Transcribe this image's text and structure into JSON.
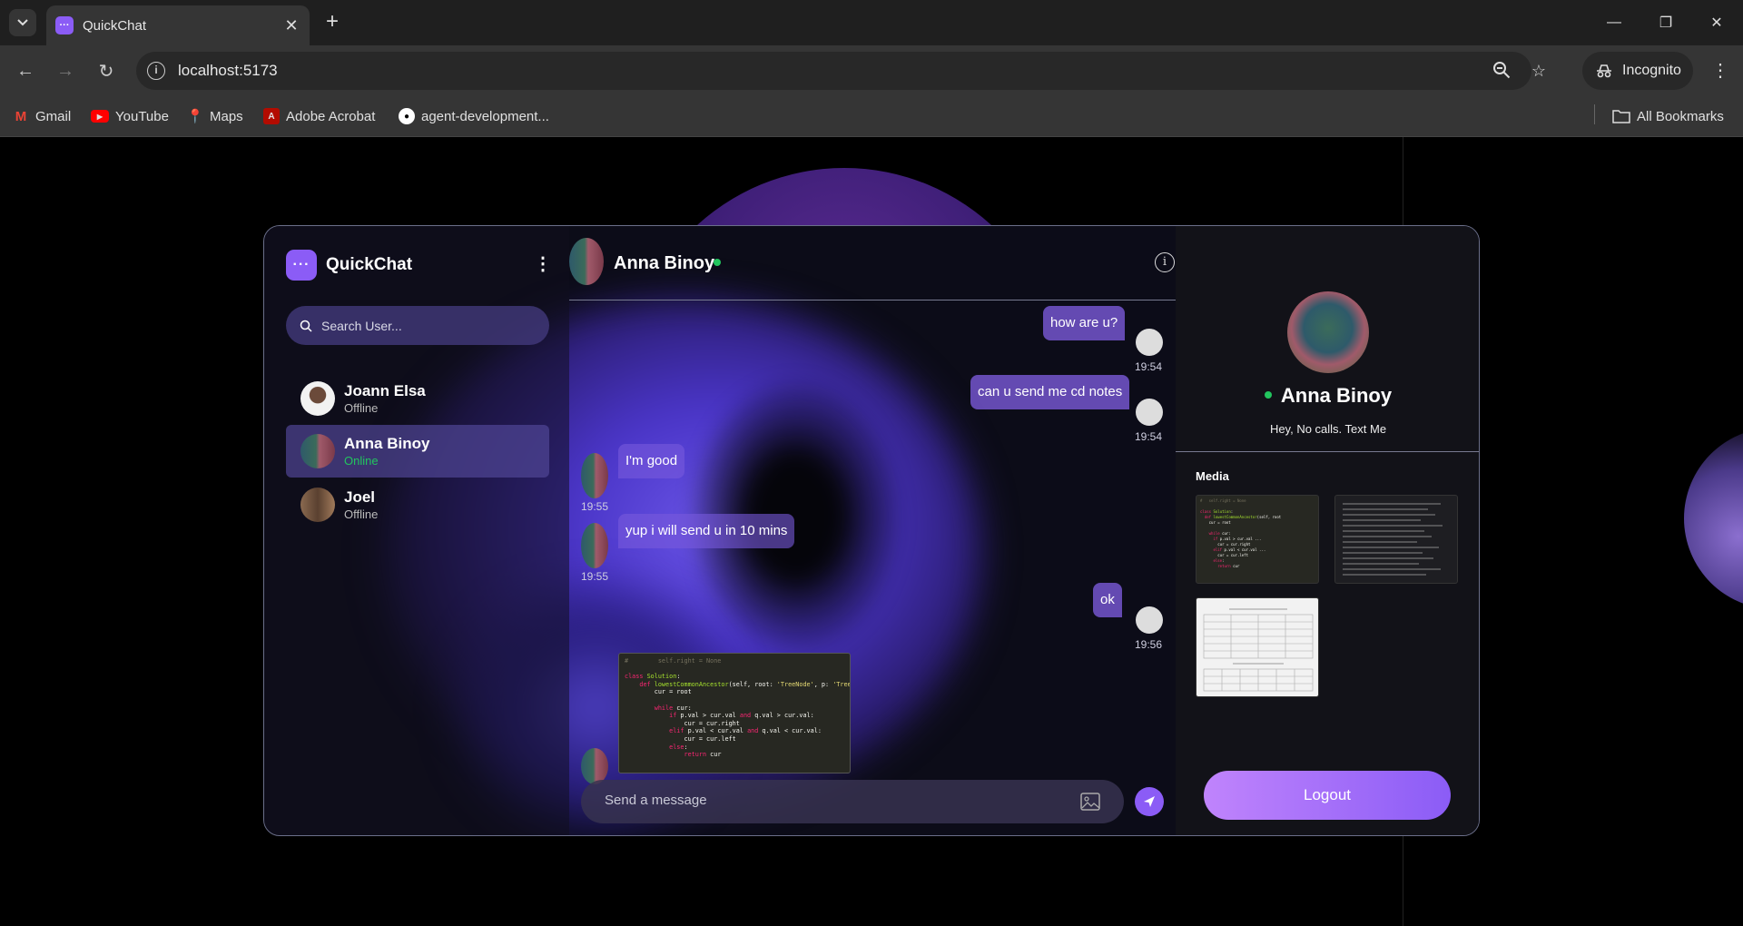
{
  "browser": {
    "tab_title": "QuickChat",
    "url": "localhost:5173",
    "profile_label": "Incognito",
    "bookmarks": [
      {
        "label": "Gmail",
        "icon": "gmail-icon"
      },
      {
        "label": "YouTube",
        "icon": "youtube-icon"
      },
      {
        "label": "Maps",
        "icon": "maps-icon"
      },
      {
        "label": "Adobe Acrobat",
        "icon": "acrobat-icon"
      },
      {
        "label": "agent-development...",
        "icon": "github-icon"
      }
    ],
    "all_bookmarks": "All Bookmarks"
  },
  "sidebar": {
    "brand": "QuickChat",
    "search_placeholder": "Search User...",
    "contacts": [
      {
        "name": "Joann Elsa",
        "status": "Offline",
        "active": false
      },
      {
        "name": "Anna Binoy",
        "status": "Online",
        "active": true
      },
      {
        "name": "Joel",
        "status": "Offline",
        "active": false
      }
    ]
  },
  "chat": {
    "header_name": "Anna Binoy",
    "messages": [
      {
        "text": "how are u?",
        "time": "19:54",
        "dir": "out"
      },
      {
        "text": "can u send me cd notes",
        "time": "19:54",
        "dir": "out"
      },
      {
        "text": "I'm good",
        "time": "19:55",
        "dir": "in"
      },
      {
        "text": "yup i will send u in 10 mins",
        "time": "19:55",
        "dir": "in"
      },
      {
        "text": "ok",
        "time": "19:56",
        "dir": "out"
      }
    ],
    "composer_placeholder": "Send a message"
  },
  "profile": {
    "name": "Anna Binoy",
    "bio": "Hey, No calls. Text Me",
    "media_label": "Media",
    "logout_label": "Logout"
  },
  "colors": {
    "accent": "#8b5cf6",
    "online": "#22c55e",
    "background": "#000000"
  }
}
